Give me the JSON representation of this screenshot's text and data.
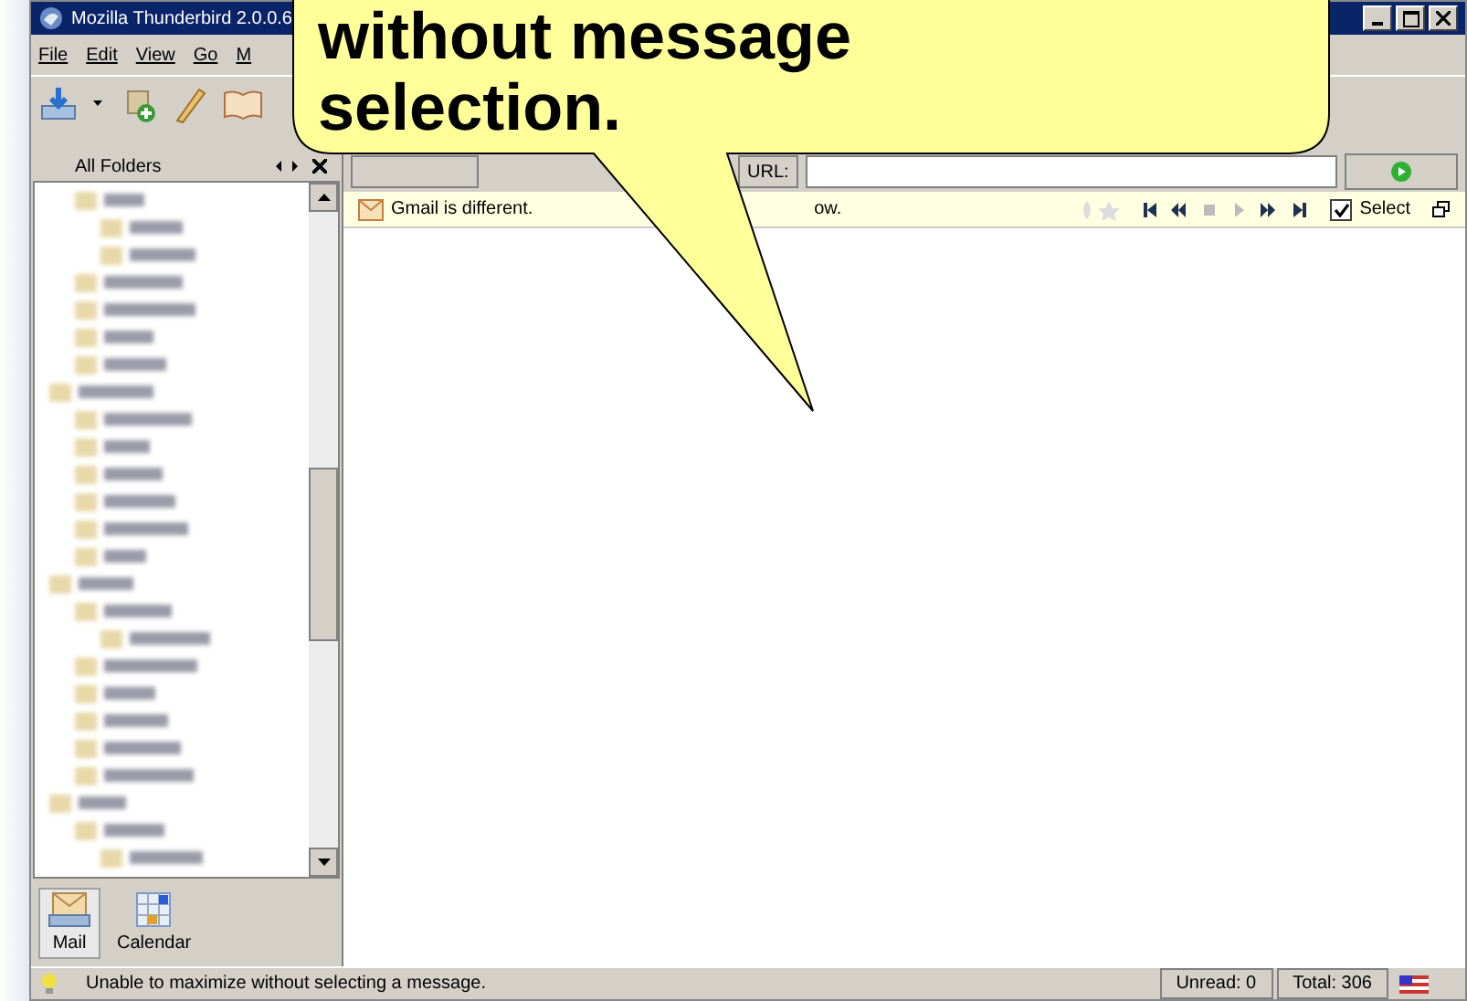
{
  "window": {
    "title": "Mozilla Thunderbird 2.0.0.6"
  },
  "menu": [
    "File",
    "Edit",
    "View",
    "Go",
    "M"
  ],
  "sidebar": {
    "header": "All Folders",
    "modes": [
      {
        "label": "Mail",
        "selected": true,
        "kind": "mail"
      },
      {
        "label": "Calendar",
        "selected": false,
        "kind": "calendar"
      }
    ]
  },
  "address_bar": {
    "label": "URL:"
  },
  "notification": {
    "text": "Gmail is different.",
    "text_tail": "ow.",
    "select_checkbox": {
      "label": "Select",
      "checked": true
    }
  },
  "callout": {
    "lines": [
      "without message",
      "selection."
    ]
  },
  "status_bar": {
    "message": "Unable to maximize without selecting a message.",
    "unread": "Unread: 0",
    "total": "Total: 306"
  }
}
